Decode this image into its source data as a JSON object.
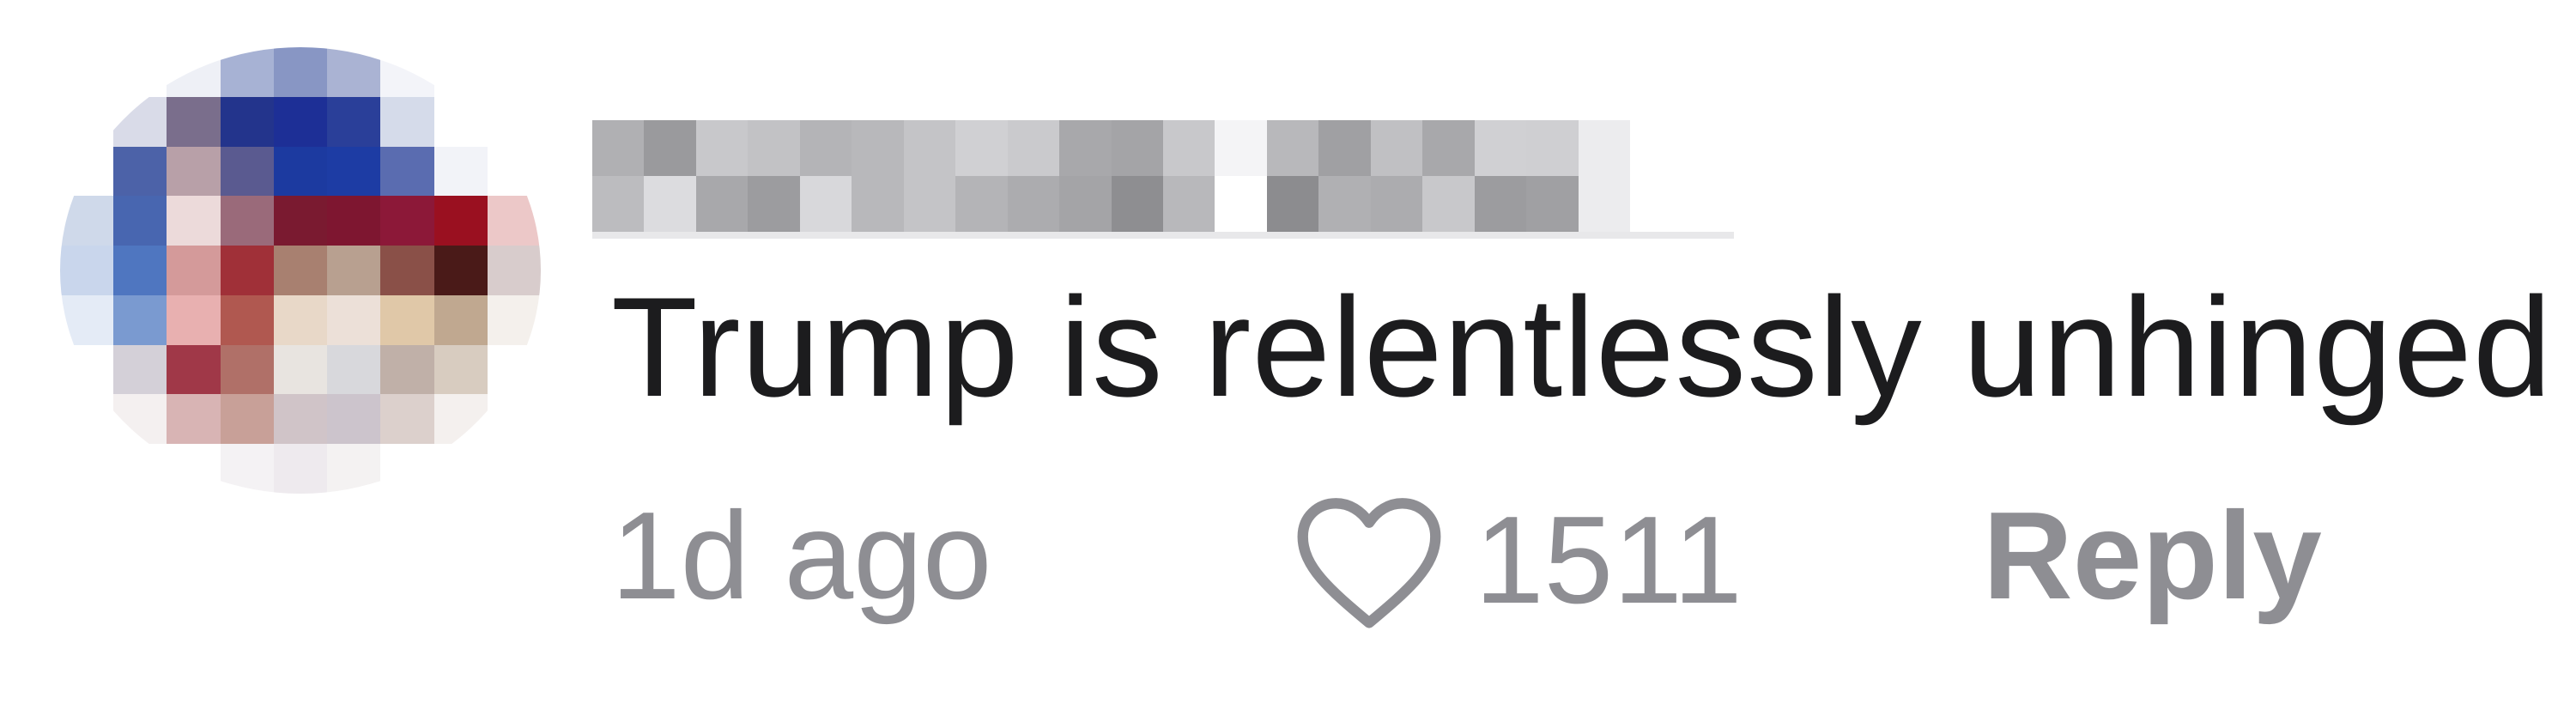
{
  "comment": {
    "text": "Trump is relentlessly unhinged",
    "timestamp": "1d ago",
    "like_count": "1511",
    "reply_label": "Reply",
    "username_state": "pixelated",
    "avatar_state": "pixelated"
  },
  "icons": {
    "like": "heart-outline-icon"
  },
  "colors": {
    "text_primary": "#1c1c1e",
    "text_secondary": "#8e8e93",
    "background": "#ffffff"
  }
}
